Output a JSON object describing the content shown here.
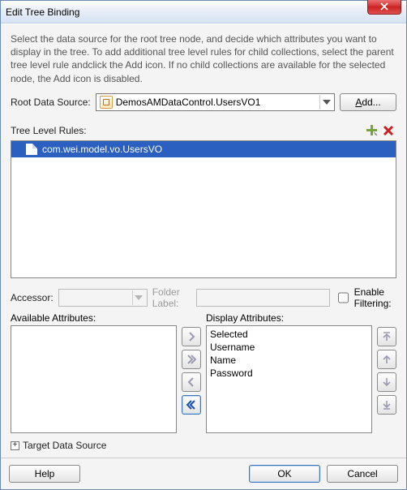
{
  "window": {
    "title": "Edit Tree Binding"
  },
  "description": "Select the data source for the root tree node, and decide which attributes you want to display in the tree. To add additional tree level rules for child collections, select the parent tree level rule andclick the Add icon. If no child collections are available for the selected node, the Add icon is disabled.",
  "rootDataSource": {
    "label": "Root Data Source:",
    "value": "DemosAMDataControl.UsersVO1",
    "addLabel": "Add..."
  },
  "treeLevel": {
    "label": "Tree Level Rules:",
    "items": [
      {
        "text": "com.wei.model.vo.UsersVO"
      }
    ]
  },
  "accessor": {
    "label": "Accessor:",
    "value": ""
  },
  "folderLabel": {
    "label": "Folder Label:",
    "value": ""
  },
  "enableFiltering": {
    "label": "Enable Filtering:",
    "checked": false
  },
  "available": {
    "label": "Available Attributes:",
    "items": []
  },
  "display": {
    "label": "Display Attributes:",
    "items": [
      "Selected",
      "Username",
      "Name",
      "Password"
    ]
  },
  "targetDataSource": {
    "label": "Target Data Source"
  },
  "buttons": {
    "help": "Help",
    "ok": "OK",
    "cancel": "Cancel"
  }
}
